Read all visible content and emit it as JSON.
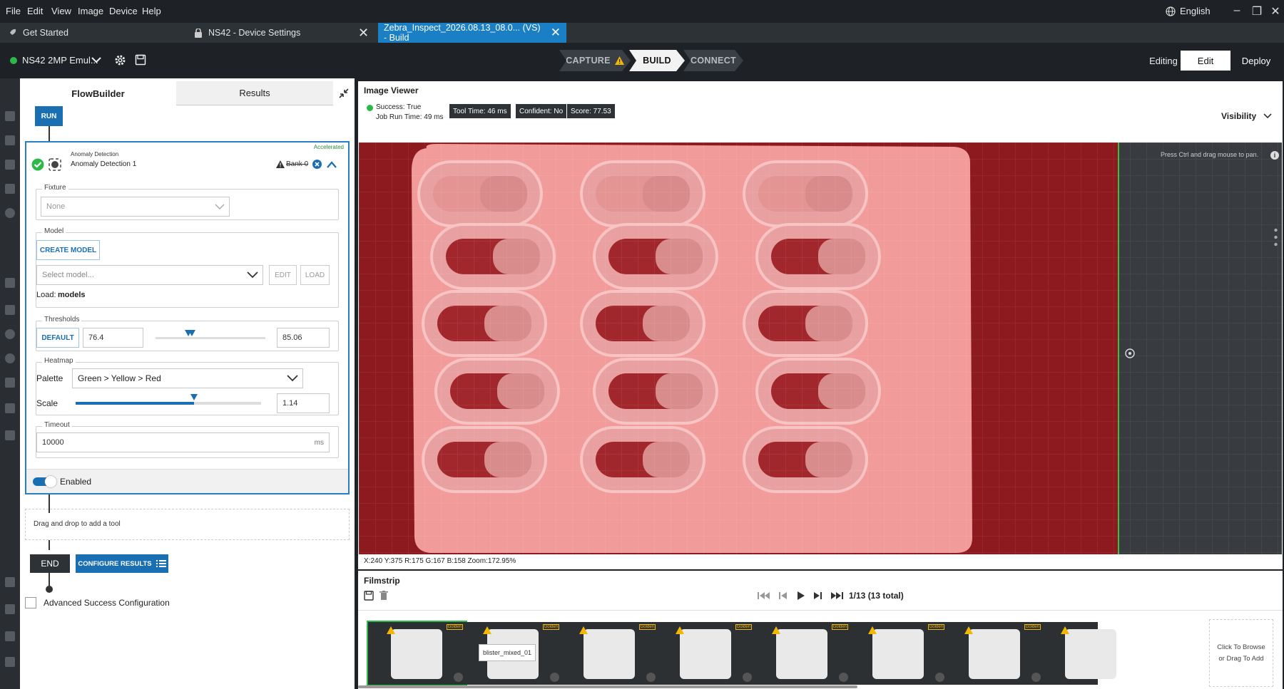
{
  "menu": [
    "File",
    "Edit",
    "View",
    "Image",
    "Device",
    "Help"
  ],
  "language": "English",
  "tabs": [
    {
      "label": "Get Started"
    },
    {
      "label": "NS42 - Device Settings"
    },
    {
      "label": "Zebra_Inspect_2026.08.13_08.0... (VS) - Build"
    }
  ],
  "device": {
    "name": "NS42 2MP Emul..."
  },
  "steps": [
    "CAPTURE",
    "BUILD",
    "CONNECT"
  ],
  "mode": {
    "status": "Editing",
    "edit": "Edit",
    "deploy": "Deploy"
  },
  "left_panel": {
    "tabs": [
      "FlowBuilder",
      "Results"
    ],
    "run": "RUN",
    "tool": {
      "accelerated": "Accelerated",
      "type": "Anomaly Detection",
      "name": "Anomaly Detection 1",
      "bank": "Bank 0",
      "fixture": {
        "legend": "Fixture",
        "value": "None"
      },
      "model": {
        "legend": "Model",
        "create": "CREATE MODEL",
        "select_placeholder": "Select model...",
        "edit": "EDIT",
        "load": "LOAD",
        "load_label": "Load:",
        "load_value": "models"
      },
      "thresholds": {
        "legend": "Thresholds",
        "default": "DEFAULT",
        "low": "76.4",
        "high": "85.06",
        "low_fraction": 0.3,
        "high_fraction": 0.33
      },
      "heatmap": {
        "legend": "Heatmap",
        "palette_label": "Palette",
        "palette": "Green > Yellow > Red",
        "scale_label": "Scale",
        "scale": "1.14",
        "scale_fraction": 0.64
      },
      "timeout": {
        "legend": "Timeout",
        "value": "10000",
        "unit": "ms"
      },
      "enabled": "Enabled"
    },
    "drop_hint": "Drag and drop to add a tool",
    "end": "END",
    "configure_results": "CONFIGURE RESULTS",
    "advanced": "Advanced Success Configuration"
  },
  "image_viewer": {
    "title": "Image Viewer",
    "success": "Success: True",
    "job_time": "Job Run Time: 49 ms",
    "badges": [
      "Tool Time:  46 ms",
      "Confident:  No",
      "Score:  77.53"
    ],
    "visibility": "Visibility",
    "pan_hint": "Press Ctrl and drag mouse to pan.",
    "coords": "X:240  Y:375    R:175 G:167 B:158   Zoom:172.95%"
  },
  "filmstrip": {
    "title": "Filmstrip",
    "counter": "1/13 (13 total)",
    "tooltip": "blister_mixed_01",
    "golden": "Golden",
    "browse_line1": "Click To Browse",
    "browse_line2": "or Drag To Add"
  },
  "colors": {
    "accent": "#1a6fb3",
    "active_tab": "#1a7fc4",
    "success": "#2db84a",
    "heatmap": "#f29b9b",
    "heatmap_dark": "#8c1a1f"
  }
}
